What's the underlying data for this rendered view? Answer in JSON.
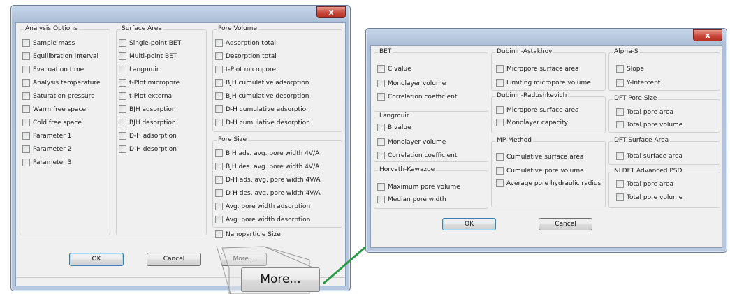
{
  "dialog1": {
    "close_label": "x",
    "analysis_options": {
      "title": "Analysis Options",
      "items": [
        "Sample mass",
        "Equilibration interval",
        "Evacuation time",
        "Analysis temperature",
        "Saturation pressure",
        "Warm free space",
        "Cold free space",
        "Parameter 1",
        "Parameter 2",
        "Parameter 3"
      ]
    },
    "surface_area": {
      "title": "Surface Area",
      "items": [
        "Single-point BET",
        "Multi-point BET",
        "Langmuir",
        "t-Plot micropore",
        "t-Plot external",
        "BJH adsorption",
        "BJH desorption",
        "D-H adsorption",
        "D-H desorption"
      ]
    },
    "pore_volume": {
      "title": "Pore Volume",
      "items": [
        "Adsorption total",
        "Desorption total",
        "t-Plot micropore",
        "BJH cumulative adsorption",
        "BJH cumulative desorption",
        "D-H cumulative adsorption",
        "D-H cumulative desorption"
      ]
    },
    "pore_size": {
      "title": "Pore Size",
      "items": [
        "BJH ads. avg. pore width 4V/A",
        "BJH des. avg. pore width 4V/A",
        "D-H ads. avg. pore width 4V/A",
        "D-H des. avg. pore width 4V/A",
        "Avg. pore width adsorption",
        "Avg. pore width desorption"
      ]
    },
    "nanoparticle_label": "Nanoparticle Size",
    "ok_label": "OK",
    "cancel_label": "Cancel",
    "more_label": "More...",
    "more_zoom_label": "More..."
  },
  "dialog2": {
    "close_label": "x",
    "bet": {
      "title": "BET",
      "items": [
        "C value",
        "Monolayer volume",
        "Correlation coefficient"
      ]
    },
    "langmuir": {
      "title": "Langmuir",
      "items": [
        "B value",
        "Monolayer volume",
        "Correlation coefficient"
      ]
    },
    "horvath": {
      "title": "Horvath-Kawazoe",
      "items": [
        "Maximum pore volume",
        "Median pore width"
      ]
    },
    "dubinin_astakhov": {
      "title": "Dubinin-Astakhov",
      "items": [
        "Micropore surface area",
        "Limiting micropore volume"
      ]
    },
    "dubinin_radushkevich": {
      "title": "Dubinin-Radushkevich",
      "items": [
        "Micropore surface area",
        "Monolayer capacity"
      ]
    },
    "mp_method": {
      "title": "MP-Method",
      "items": [
        "Cumulative surface area",
        "Cumulative pore volume",
        "Average pore hydraulic radius"
      ]
    },
    "alpha_s": {
      "title": "Alpha-S",
      "items": [
        "Slope",
        "Y-Intercept"
      ]
    },
    "dft_pore_size": {
      "title": "DFT Pore Size",
      "items": [
        "Total pore area",
        "Total pore volume"
      ]
    },
    "dft_surface_area": {
      "title": "DFT Surface Area",
      "items": [
        "Total surface area"
      ]
    },
    "nldft": {
      "title": "NLDFT Advanced PSD",
      "items": [
        "Total pore area",
        "Total pore volume"
      ]
    },
    "ok_label": "OK",
    "cancel_label": "Cancel"
  },
  "colors": {
    "arrow": "#2e9a4a",
    "close_button": "#c8473a",
    "frame": "#b7c8de"
  }
}
